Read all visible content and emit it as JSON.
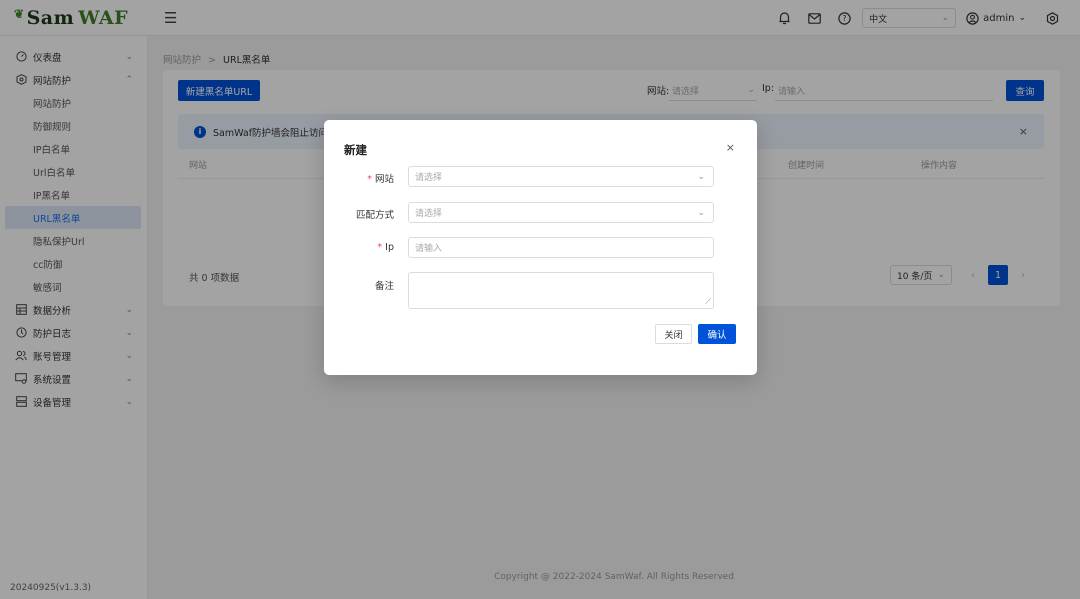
{
  "app": {
    "logo_sam": "Sam",
    "logo_waf": "WAF",
    "version": "20240925(v1.3.3)"
  },
  "topbar": {
    "language": "中文",
    "user": "admin"
  },
  "sidebar": {
    "items": [
      {
        "label": "仪表盘",
        "icon": "dashboard-icon"
      },
      {
        "label": "网站防护",
        "icon": "shield-icon"
      },
      {
        "label": "数据分析",
        "icon": "table-icon"
      },
      {
        "label": "防护日志",
        "icon": "log-icon"
      },
      {
        "label": "账号管理",
        "icon": "users-icon"
      },
      {
        "label": "系统设置",
        "icon": "system-icon"
      },
      {
        "label": "设备管理",
        "icon": "server-icon"
      }
    ],
    "subitems": [
      "网站防护",
      "防御规则",
      "IP白名单",
      "Url白名单",
      "IP黑名单",
      "URL黑名单",
      "隐私保护Url",
      "cc防御",
      "敏感词"
    ]
  },
  "breadcrumb": {
    "parent": "网站防护",
    "sep": ">",
    "current": "URL黑名单"
  },
  "toolbar": {
    "new_button": "新建黑名单URL",
    "site_label": "网站:",
    "site_placeholder": "请选择",
    "ip_label": "Ip:",
    "ip_placeholder": "请输入",
    "query_button": "查询"
  },
  "alert": {
    "text": "SamWaf防护墙会阻止访问以"
  },
  "table": {
    "columns": [
      "网站",
      "创建时间",
      "操作内容"
    ]
  },
  "pagination": {
    "total": "共 0 项数据",
    "page_size": "10 条/页",
    "current_page": "1"
  },
  "footer": {
    "text": "Copyright @ 2022-2024 SamWaf. All Rights Reserved"
  },
  "modal": {
    "title": "新建",
    "close": "×",
    "fields": {
      "site_label": "网站",
      "site_placeholder": "请选择",
      "match_label": "匹配方式",
      "match_placeholder": "请选择",
      "ip_label": "Ip",
      "ip_placeholder": "请输入",
      "remark_label": "备注"
    },
    "cancel_button": "关闭",
    "confirm_button": "确认"
  },
  "colors": {
    "primary": "#0052d9",
    "required": "#e34d59",
    "alert_bg": "#ecf2fe"
  }
}
